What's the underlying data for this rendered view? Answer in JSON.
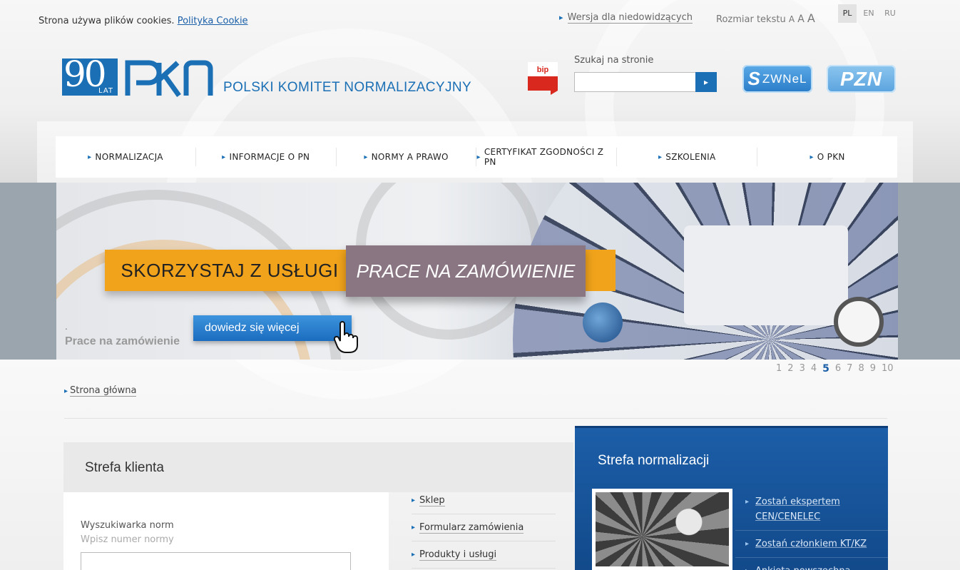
{
  "top": {
    "cookie_text": "Strona używa plików cookies.",
    "cookie_link": "Polityka Cookie",
    "accessibility_link": "Wersja dla niedowidzących",
    "text_size_label": "Rozmiar tekstu",
    "text_sizes": [
      "A",
      "A",
      "A"
    ],
    "languages": [
      {
        "code": "PL",
        "active": true
      },
      {
        "code": "EN",
        "active": false
      },
      {
        "code": "RU",
        "active": false
      }
    ]
  },
  "logo": {
    "years": "90",
    "lat": "LAT",
    "name": "POLSKI KOMITET NORMALIZACYJNY",
    "color": "#1a6fb5"
  },
  "bip_label": "bip",
  "search": {
    "label": "Szukaj na stronie",
    "value": "",
    "button_icon": "chevron-right-icon"
  },
  "partners": {
    "zwnel_text": "ZWNeL",
    "pzn_text": "PZN"
  },
  "nav": {
    "items": [
      "NORMALIZACJA",
      "INFORMACJE O PN",
      "NORMY A PRAWO",
      "CERTYFIKAT ZGODNOŚCI Z PN",
      "SZKOLENIA",
      "O PKN"
    ]
  },
  "banner": {
    "cta_left": "SKORZYSTAJ Z USŁUGI",
    "cta_right": "PRACE NA ZAMÓWIENIE",
    "more_button": "dowiedz się więcej",
    "caption": "Prace na zamówienie",
    "caption_dot": "."
  },
  "pager": {
    "pages": [
      "1",
      "2",
      "3",
      "4",
      "5",
      "6",
      "7",
      "8",
      "9",
      "10"
    ],
    "active_index": 4
  },
  "breadcrumb": {
    "home": "Strona główna"
  },
  "client_zone": {
    "title": "Strefa klienta",
    "search_label": "Wyszukiwarka norm",
    "search_hint": "Wpisz numer normy",
    "links": [
      "Sklep",
      "Formularz zamówienia",
      "Produkty i usługi"
    ]
  },
  "norm_zone": {
    "title": "Strefa normalizacji",
    "links": [
      "Zostań ekspertem CEN/CENELEC",
      "Zostań członkiem KT/KZ",
      "Ankieta powszechna"
    ],
    "color": "#1c5ea8"
  }
}
